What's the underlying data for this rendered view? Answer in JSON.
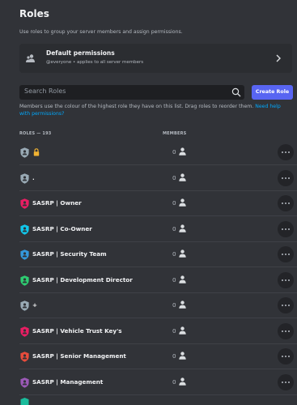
{
  "header": {
    "title": "Roles",
    "subtitle": "Use roles to group your server members and assign permissions."
  },
  "default_permissions": {
    "title": "Default permissions",
    "subtitle": "@everyone • applies to all server members"
  },
  "search": {
    "placeholder": "Search Roles"
  },
  "create_button": "Create Role",
  "help": {
    "text": "Members use the colour of the highest role they have on this list. Drag roles to reorder them.",
    "link": "Need help with permissions?"
  },
  "columns": {
    "roles": "ROLES — 193",
    "members": "MEMBERS"
  },
  "roles": [
    {
      "name": "",
      "members": "0",
      "color": "#99aab5",
      "locked": true
    },
    {
      "name": ".",
      "members": "0",
      "color": "#99aab5",
      "locked": false
    },
    {
      "name": "SASRP | Owner",
      "members": "0",
      "color": "#e91e63",
      "locked": false
    },
    {
      "name": "SASRP | Co-Owner",
      "members": "0",
      "color": "#11c6ea",
      "locked": false
    },
    {
      "name": "SASRP | Security Team",
      "members": "0",
      "color": "#3498db",
      "locked": false
    },
    {
      "name": "SASRP | Development Director",
      "members": "0",
      "color": "#2ecc71",
      "locked": false
    },
    {
      "name": "+",
      "members": "0",
      "color": "#99aab5",
      "locked": false
    },
    {
      "name": "SASRP | Vehicle Trust Key's",
      "members": "0",
      "color": "#e91e63",
      "locked": false
    },
    {
      "name": "SASRP | Senior Management",
      "members": "0",
      "color": "#e74c3c",
      "locked": false
    },
    {
      "name": "SASRP | Management",
      "members": "0",
      "color": "#9b59b6",
      "locked": false
    }
  ],
  "partial_role": {
    "color": "#1abc9c"
  }
}
